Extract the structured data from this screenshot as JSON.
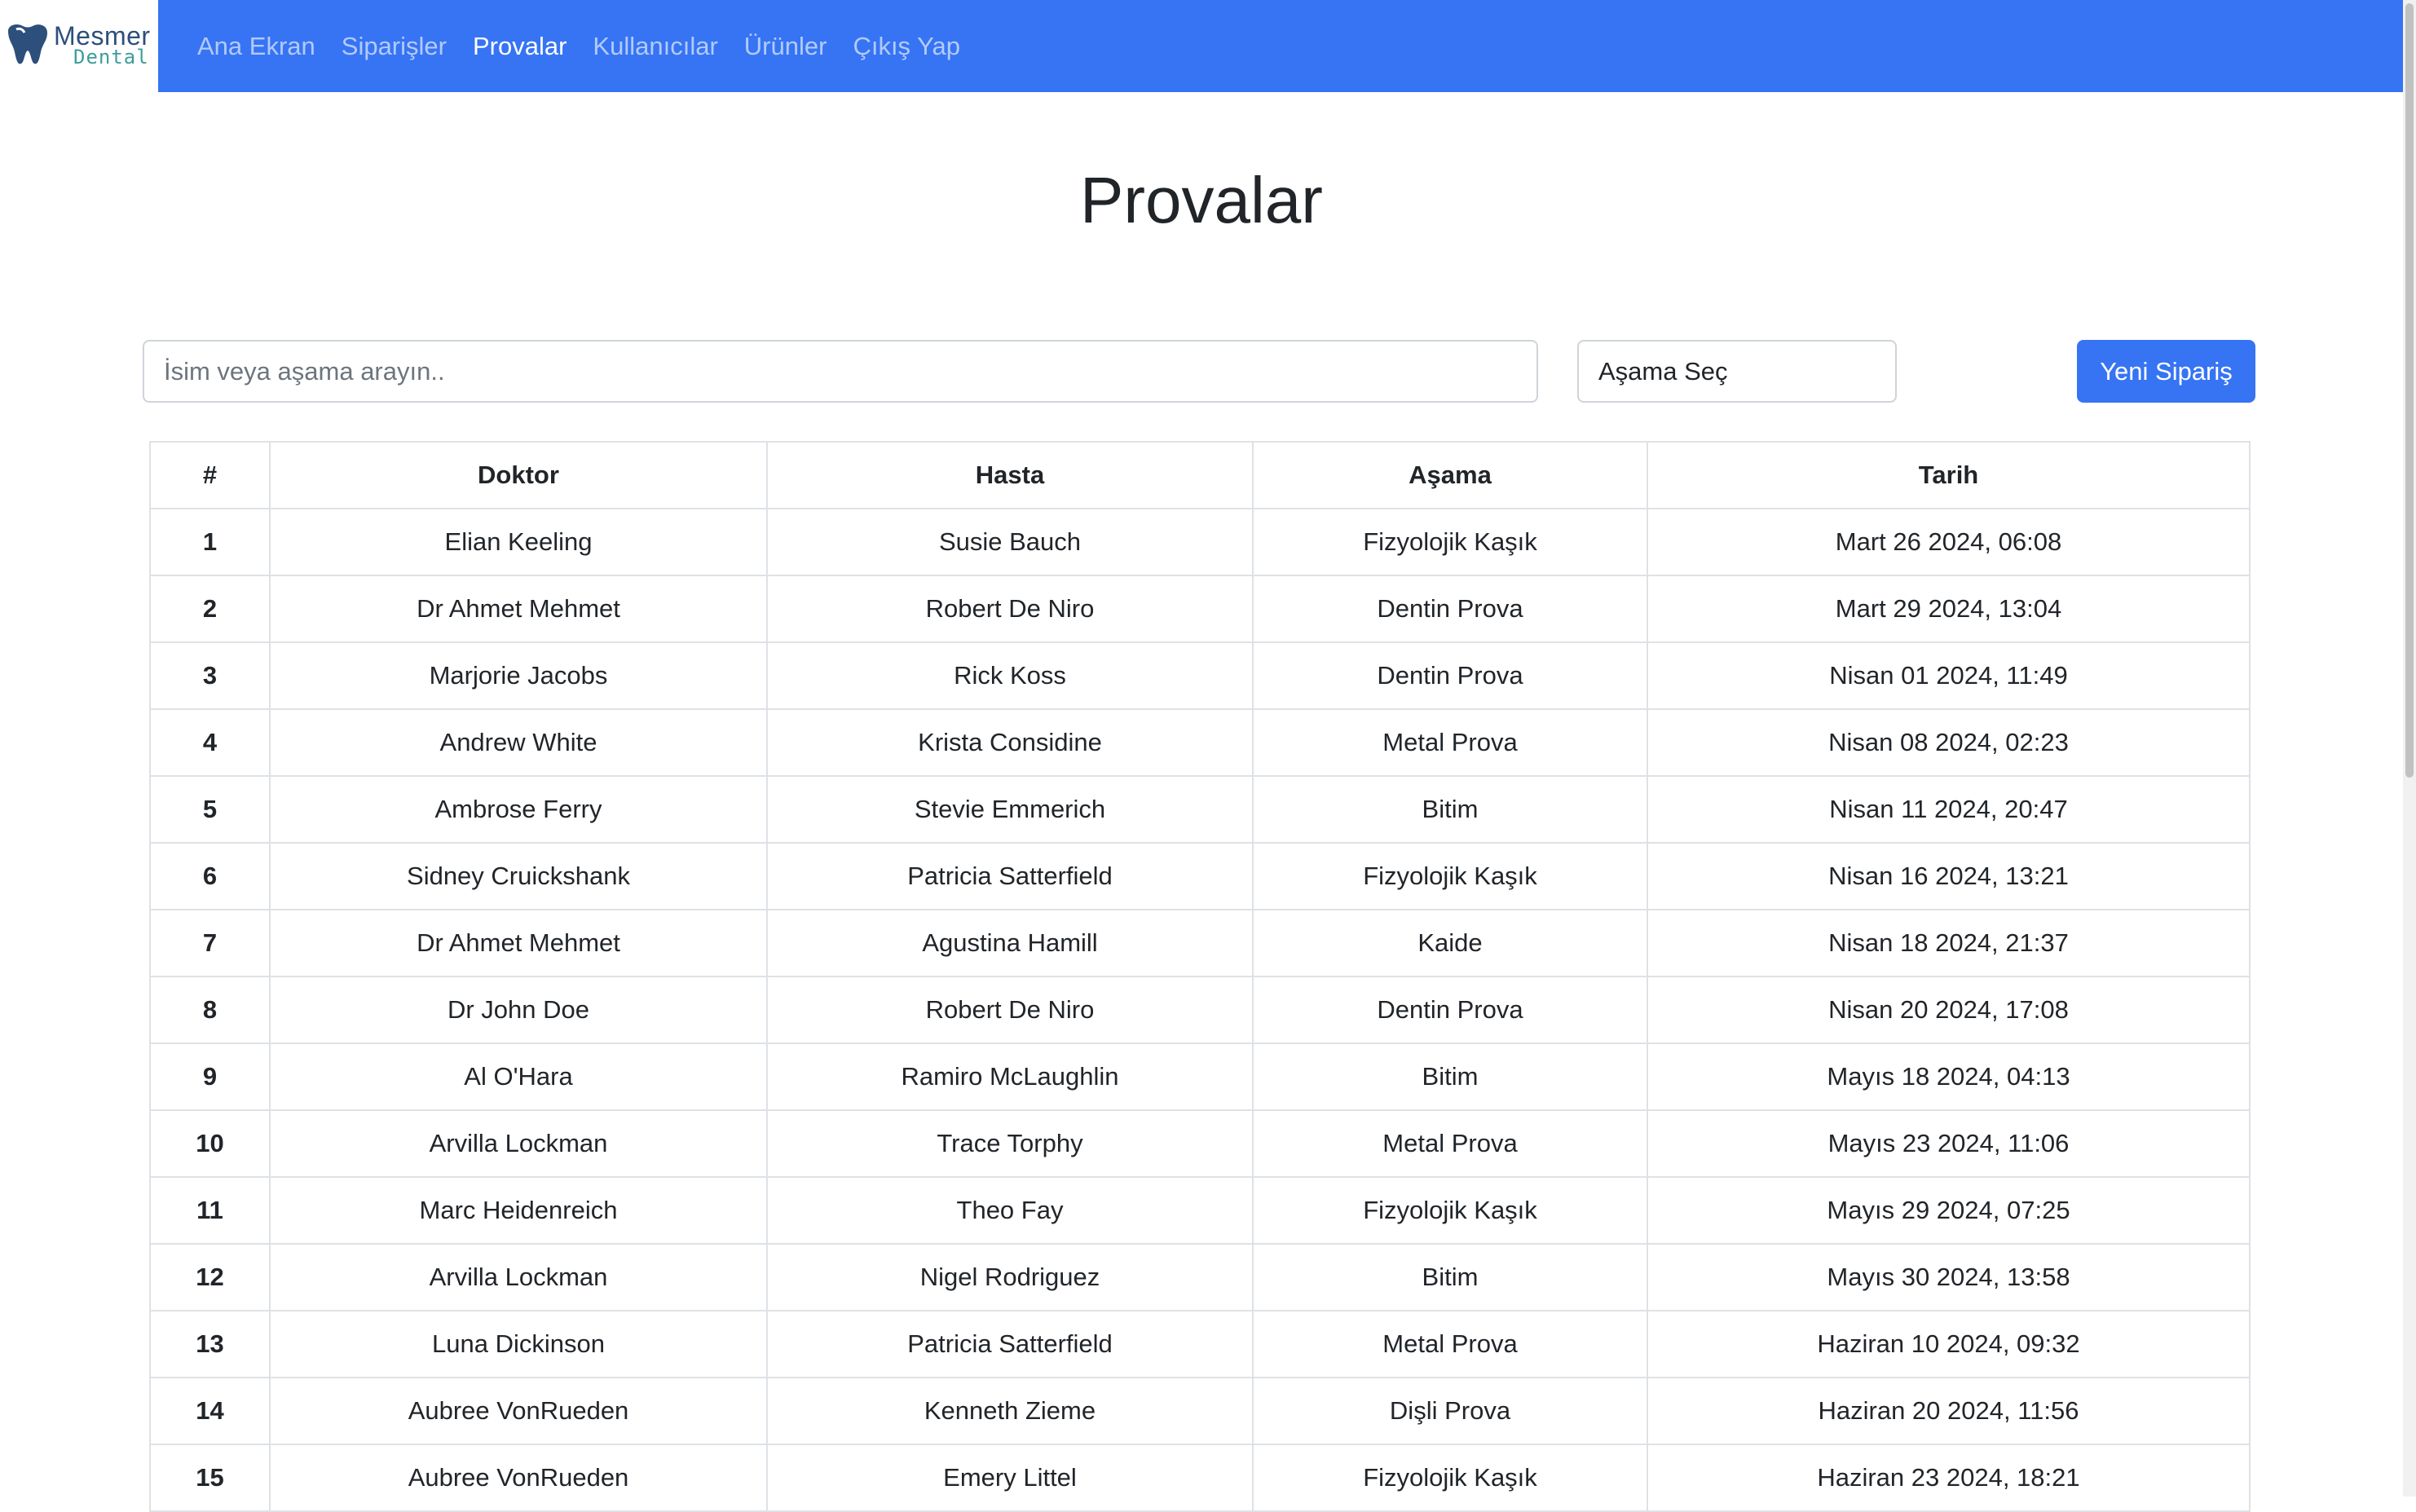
{
  "brand": {
    "name_line1": "Mesmer",
    "name_line2": "Dental",
    "colors": {
      "navbar": "#3674f4",
      "logo_primary": "#2d4f7c",
      "logo_accent": "#3d9d9b"
    }
  },
  "nav": {
    "items": [
      {
        "label": "Ana Ekran",
        "active": false
      },
      {
        "label": "Siparişler",
        "active": false
      },
      {
        "label": "Provalar",
        "active": true
      },
      {
        "label": "Kullanıcılar",
        "active": false
      },
      {
        "label": "Ürünler",
        "active": false
      },
      {
        "label": "Çıkış Yap",
        "active": false
      }
    ]
  },
  "page": {
    "title": "Provalar"
  },
  "controls": {
    "search_placeholder": "İsim veya aşama arayın..",
    "search_value": "",
    "stage_select_label": "Aşama Seç",
    "new_order_label": "Yeni Sipariş"
  },
  "table": {
    "headers": [
      "#",
      "Doktor",
      "Hasta",
      "Aşama",
      "Tarih"
    ],
    "rows": [
      [
        "1",
        "Elian Keeling",
        "Susie Bauch",
        "Fizyolojik Kaşık",
        "Mart 26 2024, 06:08"
      ],
      [
        "2",
        "Dr Ahmet Mehmet",
        "Robert De Niro",
        "Dentin Prova",
        "Mart 29 2024, 13:04"
      ],
      [
        "3",
        "Marjorie Jacobs",
        "Rick Koss",
        "Dentin Prova",
        "Nisan 01 2024, 11:49"
      ],
      [
        "4",
        "Andrew White",
        "Krista Considine",
        "Metal Prova",
        "Nisan 08 2024, 02:23"
      ],
      [
        "5",
        "Ambrose Ferry",
        "Stevie Emmerich",
        "Bitim",
        "Nisan 11 2024, 20:47"
      ],
      [
        "6",
        "Sidney Cruickshank",
        "Patricia Satterfield",
        "Fizyolojik Kaşık",
        "Nisan 16 2024, 13:21"
      ],
      [
        "7",
        "Dr Ahmet Mehmet",
        "Agustina Hamill",
        "Kaide",
        "Nisan 18 2024, 21:37"
      ],
      [
        "8",
        "Dr John Doe",
        "Robert De Niro",
        "Dentin Prova",
        "Nisan 20 2024, 17:08"
      ],
      [
        "9",
        "Al O'Hara",
        "Ramiro McLaughlin",
        "Bitim",
        "Mayıs 18 2024, 04:13"
      ],
      [
        "10",
        "Arvilla Lockman",
        "Trace Torphy",
        "Metal Prova",
        "Mayıs 23 2024, 11:06"
      ],
      [
        "11",
        "Marc Heidenreich",
        "Theo Fay",
        "Fizyolojik Kaşık",
        "Mayıs 29 2024, 07:25"
      ],
      [
        "12",
        "Arvilla Lockman",
        "Nigel Rodriguez",
        "Bitim",
        "Mayıs 30 2024, 13:58"
      ],
      [
        "13",
        "Luna Dickinson",
        "Patricia Satterfield",
        "Metal Prova",
        "Haziran 10 2024, 09:32"
      ],
      [
        "14",
        "Aubree VonRueden",
        "Kenneth Zieme",
        "Dişli Prova",
        "Haziran 20 2024, 11:56"
      ],
      [
        "15",
        "Aubree VonRueden",
        "Emery Littel",
        "Fizyolojik Kaşık",
        "Haziran 23 2024, 18:21"
      ]
    ]
  }
}
